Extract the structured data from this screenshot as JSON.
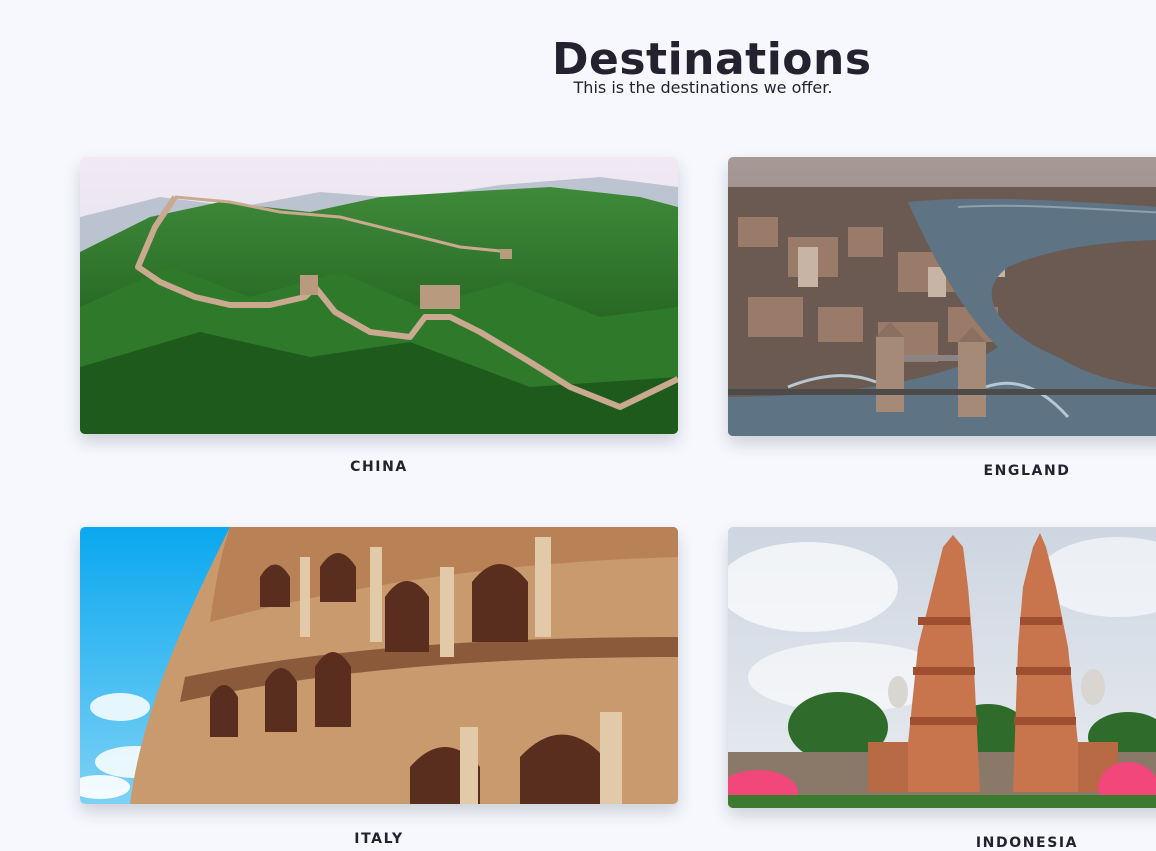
{
  "header": {
    "title": "Destinations",
    "subtitle": "This is the destinations we offer."
  },
  "destinations": [
    {
      "name": "CHINA",
      "icon": "great-wall-photo"
    },
    {
      "name": "ENGLAND",
      "icon": "tower-bridge-photo"
    },
    {
      "name": "ITALY",
      "icon": "colosseum-photo"
    },
    {
      "name": "INDONESIA",
      "icon": "bali-gate-photo"
    }
  ],
  "colors": {
    "background": "#f6f8fd",
    "text": "#25222f"
  }
}
